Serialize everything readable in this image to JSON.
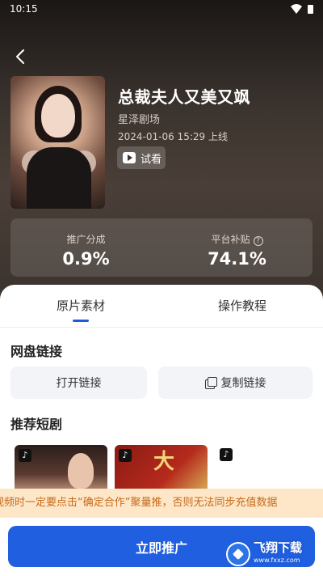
{
  "status_bar": {
    "time": "10:15"
  },
  "drama": {
    "title": "总裁夫人又美又飒",
    "studio": "星泽剧场",
    "publish_time": "2024-01-06 15:29 上线",
    "trial_label": "试看"
  },
  "stats": {
    "share_label": "推广分成",
    "share_value": "0.9%",
    "subsidy_label": "平台补贴",
    "subsidy_value": "74.1%"
  },
  "tabs": [
    {
      "label": "原片素材",
      "active": true
    },
    {
      "label": "操作教程",
      "active": false
    }
  ],
  "netdisk": {
    "title": "网盘链接",
    "open_label": "打开链接",
    "copy_label": "复制链接"
  },
  "recommend": {
    "title": "推荐短剧",
    "thumb2_char": "大"
  },
  "banner": {
    "text": "视频时一定要点击“确定合作”聚量推，否则无法同步充值数据"
  },
  "cta": {
    "label": "立即推广"
  },
  "watermark": {
    "text": "飞翔下载",
    "sub": "www.fxxz.com"
  },
  "colors": {
    "accent": "#1f5fe0",
    "banner_bg": "#fde7c8",
    "banner_text": "#c86a1a"
  }
}
